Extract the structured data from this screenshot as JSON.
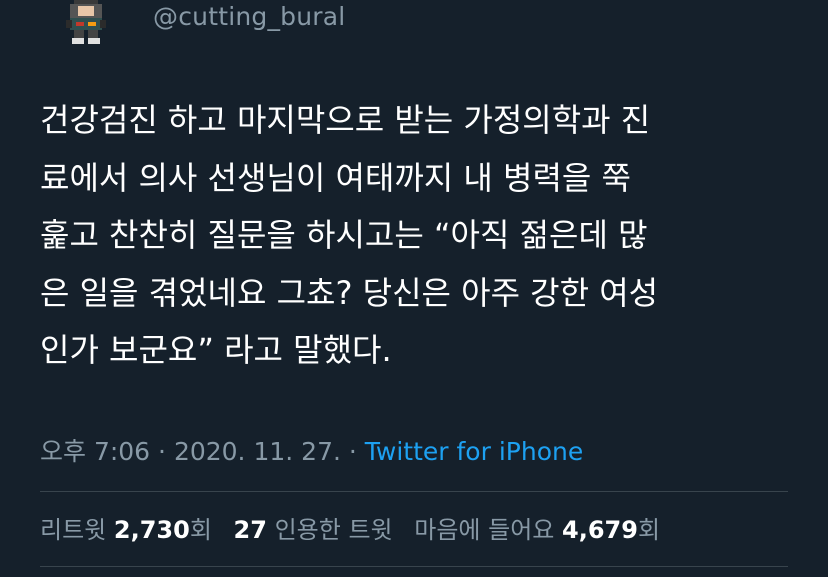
{
  "tweet": {
    "handle": "@cutting_bural",
    "body_lines": [
      "건강검진 하고 마지막으로 받는 가정의학과 진",
      "료에서 의사 선생님이 여태까지 내 병력을 쭉",
      "훑고 찬찬히 질문을 하시고는 “아직 젊은데 많",
      "은 일을 겪었네요 그쵸? 당신은 아주 강한 여성",
      "인가 보군요” 라고 말했다."
    ],
    "time": "오후 7:06",
    "separator": " · ",
    "date": "2020. 11. 27.",
    "source": "Twitter for iPhone"
  },
  "stats": {
    "retweet_label": "리트윗",
    "retweet_count": "2,730",
    "retweet_suffix": "회",
    "quote_count": "27",
    "quote_label": "인용한 트윗",
    "like_label": "마음에 들어요",
    "like_count": "4,679",
    "like_suffix": "회"
  },
  "colors": {
    "background": "#15202b",
    "text": "#ffffff",
    "muted": "#8899a6",
    "accent": "#1da1f2",
    "divider": "#38444d"
  },
  "icons": {
    "avatar": "pixel-character-avatar"
  }
}
